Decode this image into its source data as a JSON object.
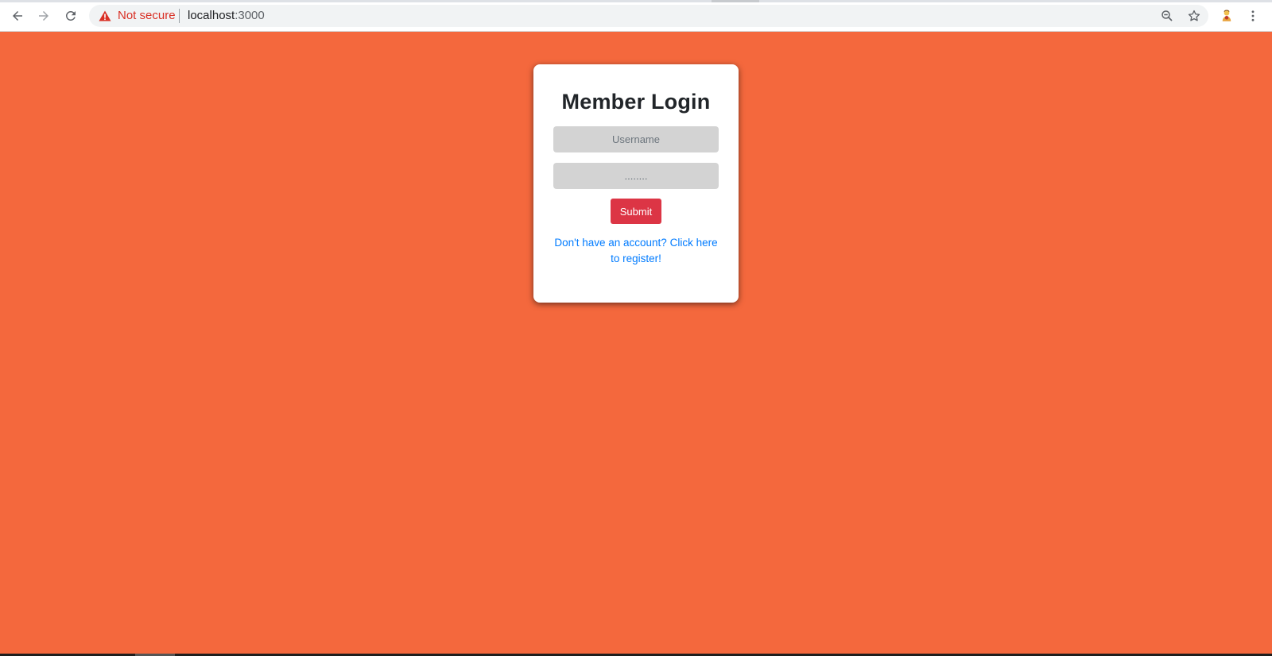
{
  "browser": {
    "security_label": "Not secure",
    "url_host": "localhost",
    "url_port": ":3000",
    "icons": [
      "back-arrow-icon",
      "forward-arrow-icon",
      "reload-icon",
      "warning-icon",
      "zoom-icon",
      "star-icon",
      "profile-avatar",
      "kebab-menu-icon"
    ]
  },
  "login": {
    "title": "Member Login",
    "username_placeholder": "Username",
    "password_value": "........",
    "submit_label": "Submit",
    "register_link": "Don't have an account? Click here to register!"
  },
  "colors": {
    "page_background": "#f4683d",
    "submit_button": "#dc3545",
    "link": "#007bff",
    "input_background": "#d3d3d3",
    "insecure_text": "#d93025"
  }
}
